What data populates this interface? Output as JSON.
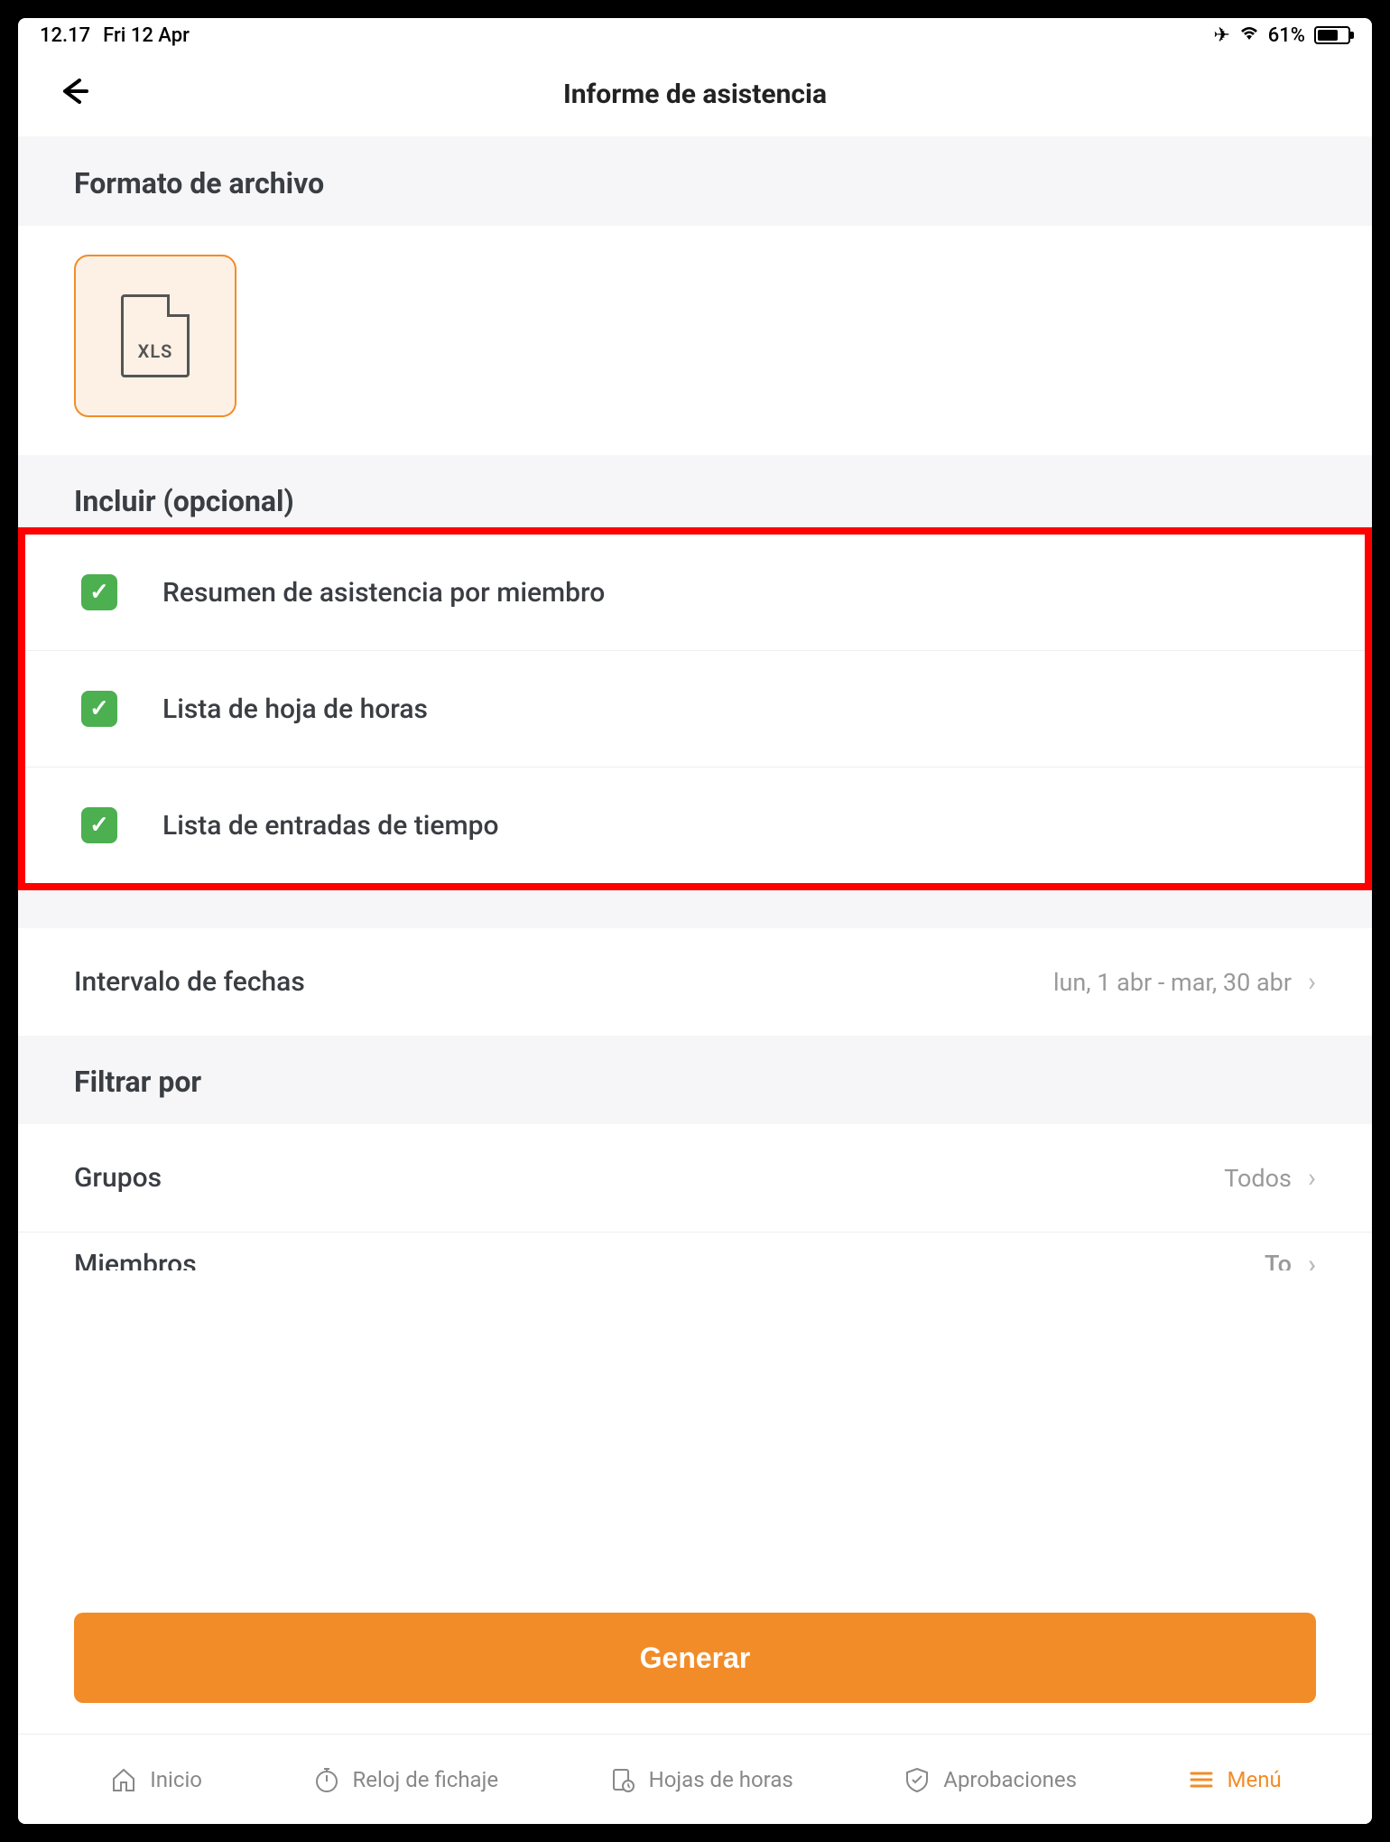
{
  "status": {
    "time": "12.17",
    "date": "Fri 12 Apr",
    "battery": "61%"
  },
  "nav": {
    "title": "Informe de asistencia"
  },
  "sections": {
    "file_format": "Formato de archivo",
    "include": "Incluir (opcional)",
    "filter_by": "Filtrar por"
  },
  "file": {
    "xls": "XLS"
  },
  "include_options": [
    {
      "label": "Resumen de asistencia por miembro",
      "checked": true
    },
    {
      "label": "Lista de hoja de horas",
      "checked": true
    },
    {
      "label": "Lista de entradas de tiempo",
      "checked": true
    }
  ],
  "date_range": {
    "label": "Intervalo de fechas",
    "value": "lun, 1 abr - mar, 30 abr"
  },
  "filters": {
    "groups": {
      "label": "Grupos",
      "value": "Todos"
    },
    "members": {
      "label": "Miembros",
      "value": "To"
    }
  },
  "buttons": {
    "generate": "Generar"
  },
  "tabs": {
    "home": "Inicio",
    "clock": "Reloj de fichaje",
    "timesheets": "Hojas de horas",
    "approvals": "Aprobaciones",
    "menu": "Menú"
  }
}
